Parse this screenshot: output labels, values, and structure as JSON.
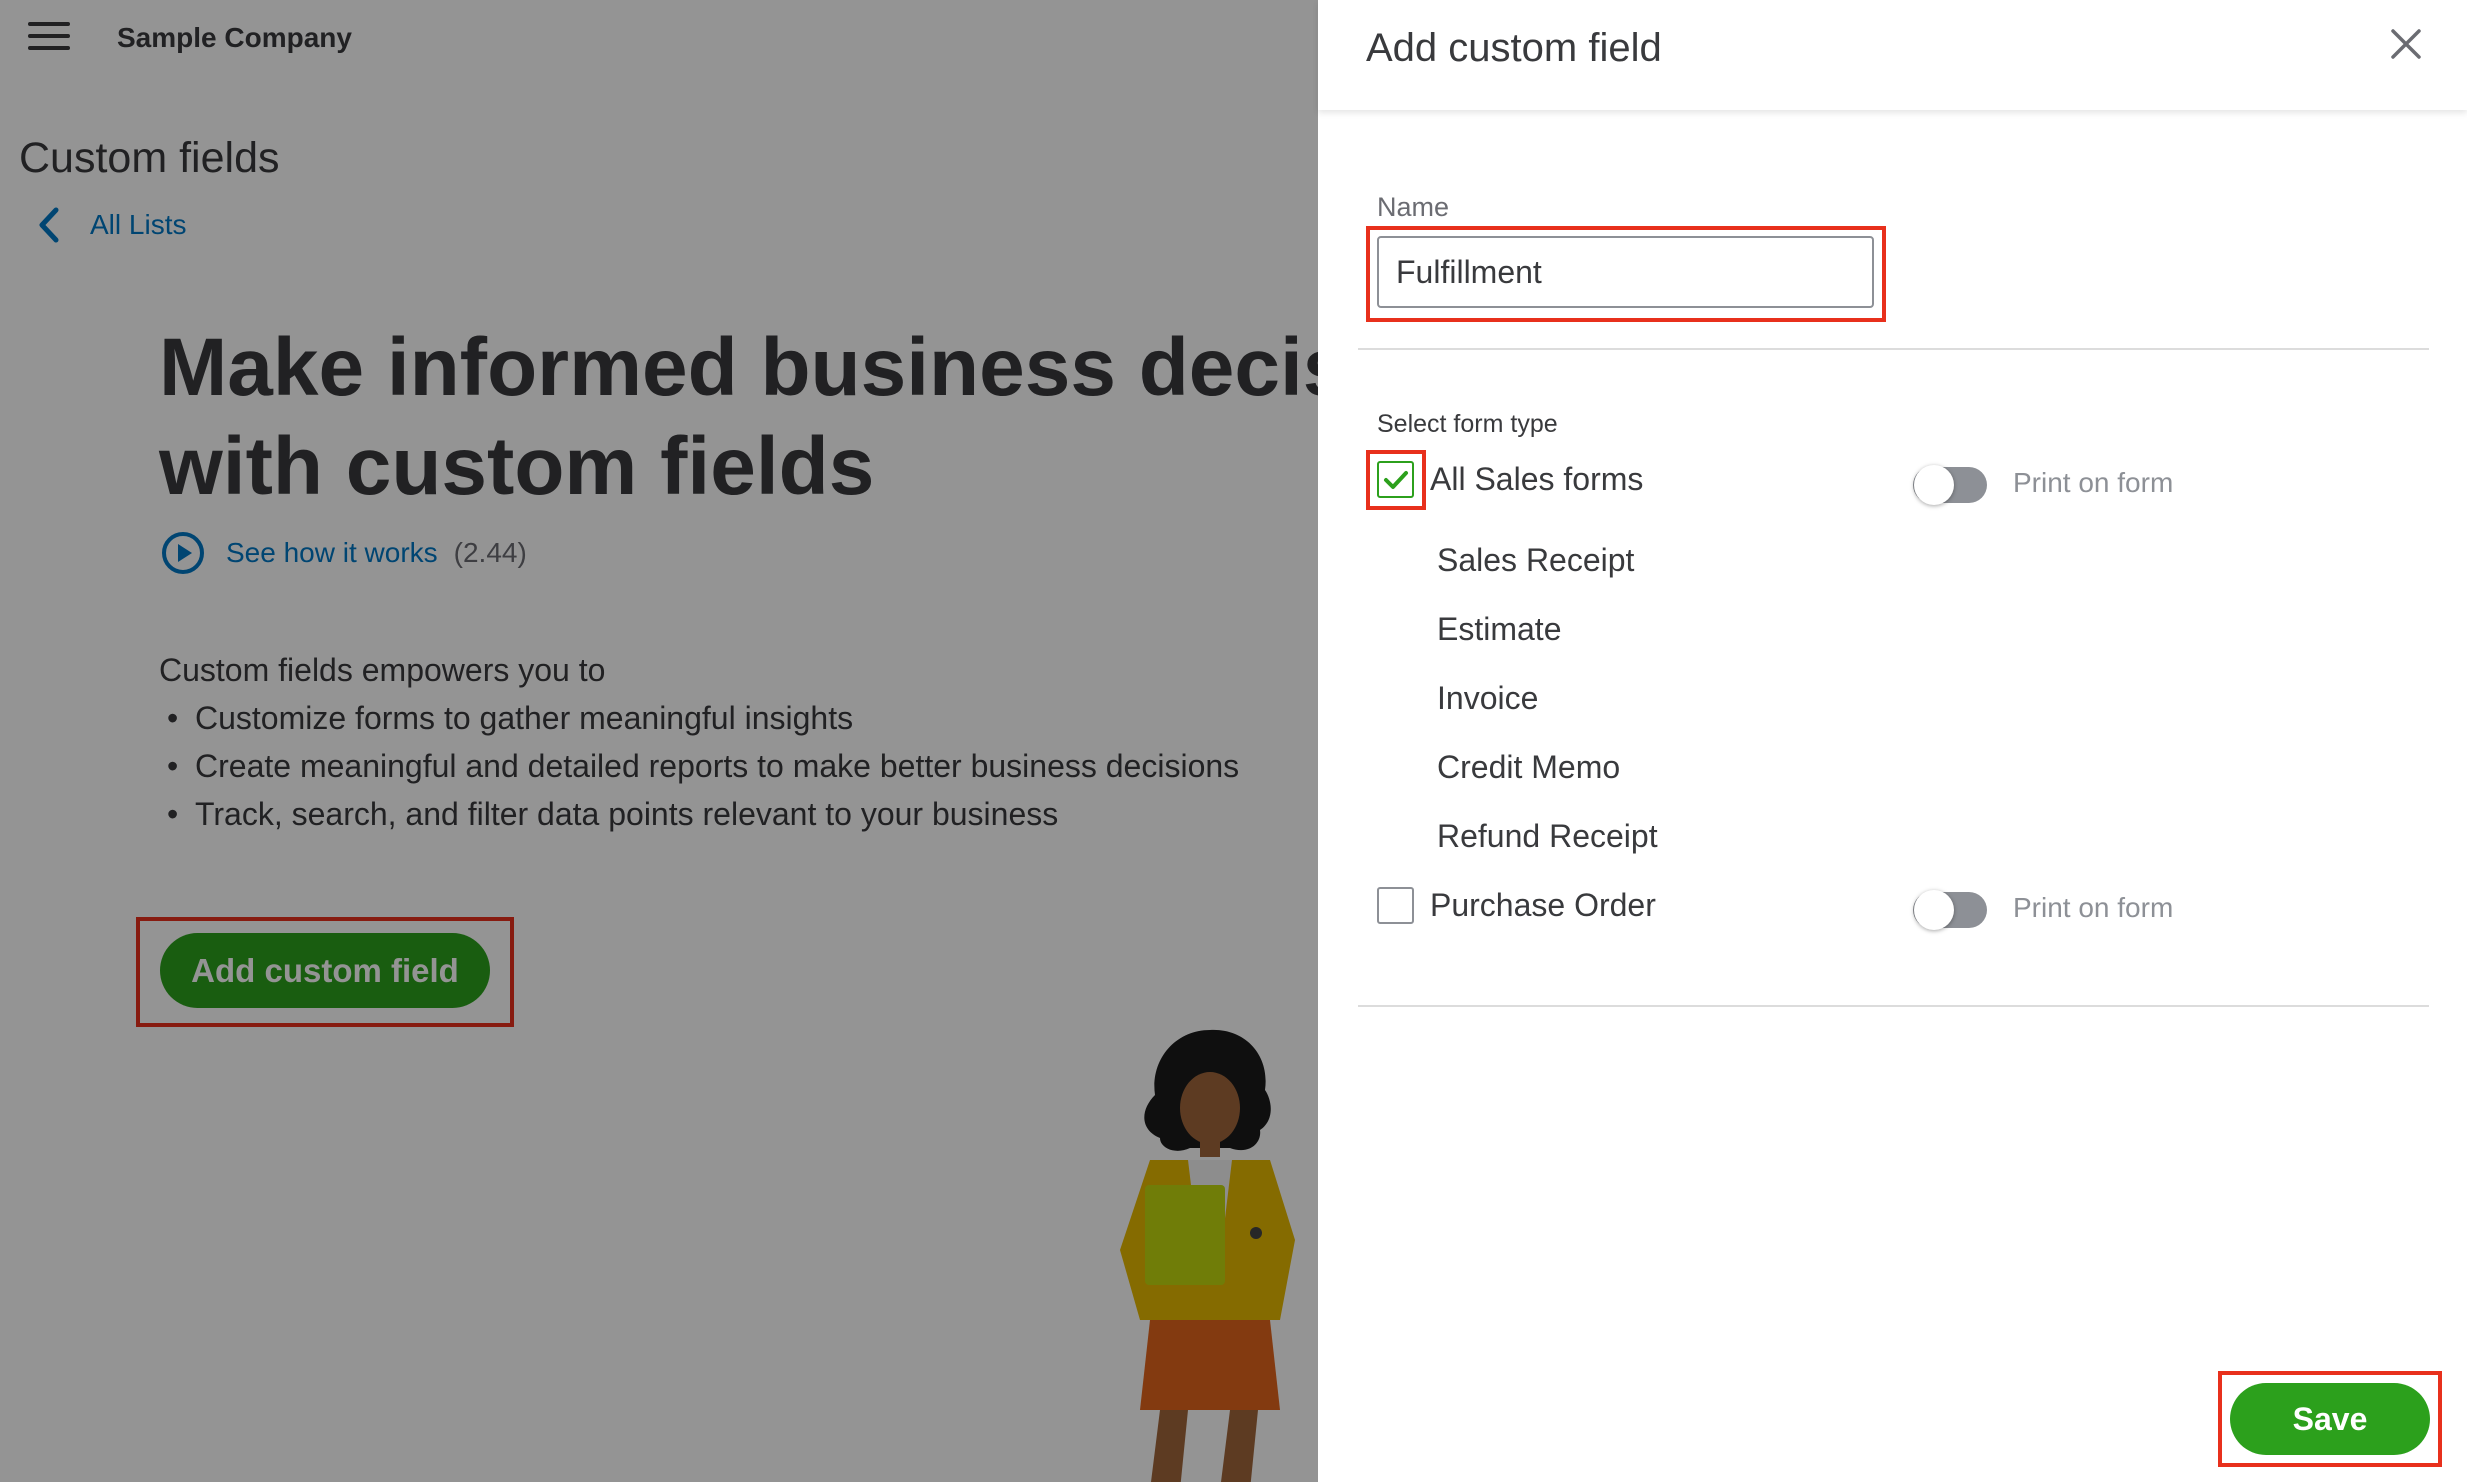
{
  "background": {
    "company_name": "Sample Company",
    "page_title": "Custom fields",
    "back_link": "All Lists",
    "hero_line1": "Make informed business decisions",
    "hero_line2": "with custom fields",
    "see_how": "See how it works",
    "video_duration": "(2.44)",
    "intro": "Custom fields empowers you to",
    "bullets": [
      "Customize forms to gather meaningful insights",
      "Create meaningful and detailed reports to make better business decisions",
      "Track, search, and filter data points relevant to your business"
    ],
    "add_button": "Add custom field"
  },
  "panel": {
    "title": "Add custom field",
    "name_label": "Name",
    "name_value": "Fulfillment",
    "section_label": "Select form type",
    "all_sales": {
      "label": "All Sales forms",
      "checked": true,
      "print_label": "Print on form",
      "print_on": false
    },
    "sales_sub_items": [
      "Sales Receipt",
      "Estimate",
      "Invoice",
      "Credit Memo",
      "Refund Receipt"
    ],
    "purchase_order": {
      "label": "Purchase Order",
      "checked": false,
      "print_label": "Print on form",
      "print_on": false
    },
    "save_button": "Save"
  },
  "colors": {
    "brand_green": "#2ca01c",
    "link_blue": "#0077c5",
    "highlight_red": "#e8301c",
    "text_dark": "#393a3d"
  },
  "icons": [
    "hamburger-icon",
    "chevron-left-icon",
    "play-circle-icon",
    "close-icon",
    "checkmark-icon"
  ]
}
